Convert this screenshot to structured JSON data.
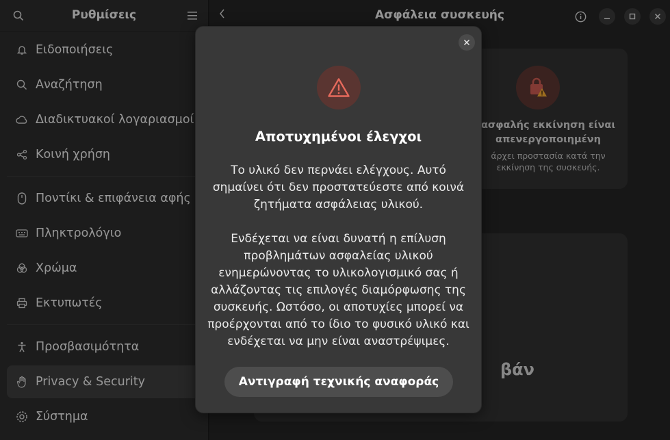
{
  "sidebar": {
    "title": "Ρυθμίσεις",
    "items": [
      {
        "label": "Ειδοποιήσεις",
        "icon": "bell-icon"
      },
      {
        "label": "Αναζήτηση",
        "icon": "search-icon"
      },
      {
        "label": "Διαδικτυακοί λογαριασμοί",
        "icon": "cloud-icon"
      },
      {
        "label": "Κοινή χρήση",
        "icon": "share-icon"
      },
      {
        "label": "Ποντίκι & επιφάνεια αφής",
        "icon": "mouse-icon"
      },
      {
        "label": "Πληκτρολόγιο",
        "icon": "keyboard-icon"
      },
      {
        "label": "Χρώμα",
        "icon": "color-icon"
      },
      {
        "label": "Εκτυπωτές",
        "icon": "printer-icon"
      },
      {
        "label": "Προσβασιμότητα",
        "icon": "accessibility-icon"
      },
      {
        "label": "Privacy & Security",
        "icon": "hand-icon"
      },
      {
        "label": "Σύστημα",
        "icon": "system-gear-icon"
      }
    ],
    "active_item": "Privacy & Security"
  },
  "main": {
    "title": "Ασφάλεια συσκευής",
    "card": {
      "title": "ασφαλής εκκίνηση είναι απενεργοποιημένη",
      "subtitle": "άρχει προστασία κατά την εκκίνηση της συσκευής."
    },
    "lower_card_text": "βάν"
  },
  "dialog": {
    "title": "Αποτυχημένοι έλεγχοι",
    "paragraph1": "Το υλικό δεν περνάει ελέγχους. Αυτό σημαίνει ότι δεν προστατεύεστε από κοινά ζητήματα ασφάλειας υλικού.",
    "paragraph2": "Ενδέχεται να είναι δυνατή η επίλυση προβλημάτων ασφαλείας υλικού ενημερώνοντας το υλικολογισμικό σας ή αλλάζοντας τις επιλογές διαμόρφωσης της συσκευής. Ωστόσο, οι αποτυχίες μπορεί να προέρχονται από το ίδιο το φυσικό υλικό και ενδέχεται να μην είναι αναστρέψιμες.",
    "button_label": "Αντιγραφή τεχνικής αναφοράς",
    "icon": "warning-icon"
  },
  "colors": {
    "warning_red": "#e66a5c",
    "warning_bg": "#5a3531",
    "sidebar_bg": "#2c2c2c",
    "dialog_bg": "#383838"
  }
}
